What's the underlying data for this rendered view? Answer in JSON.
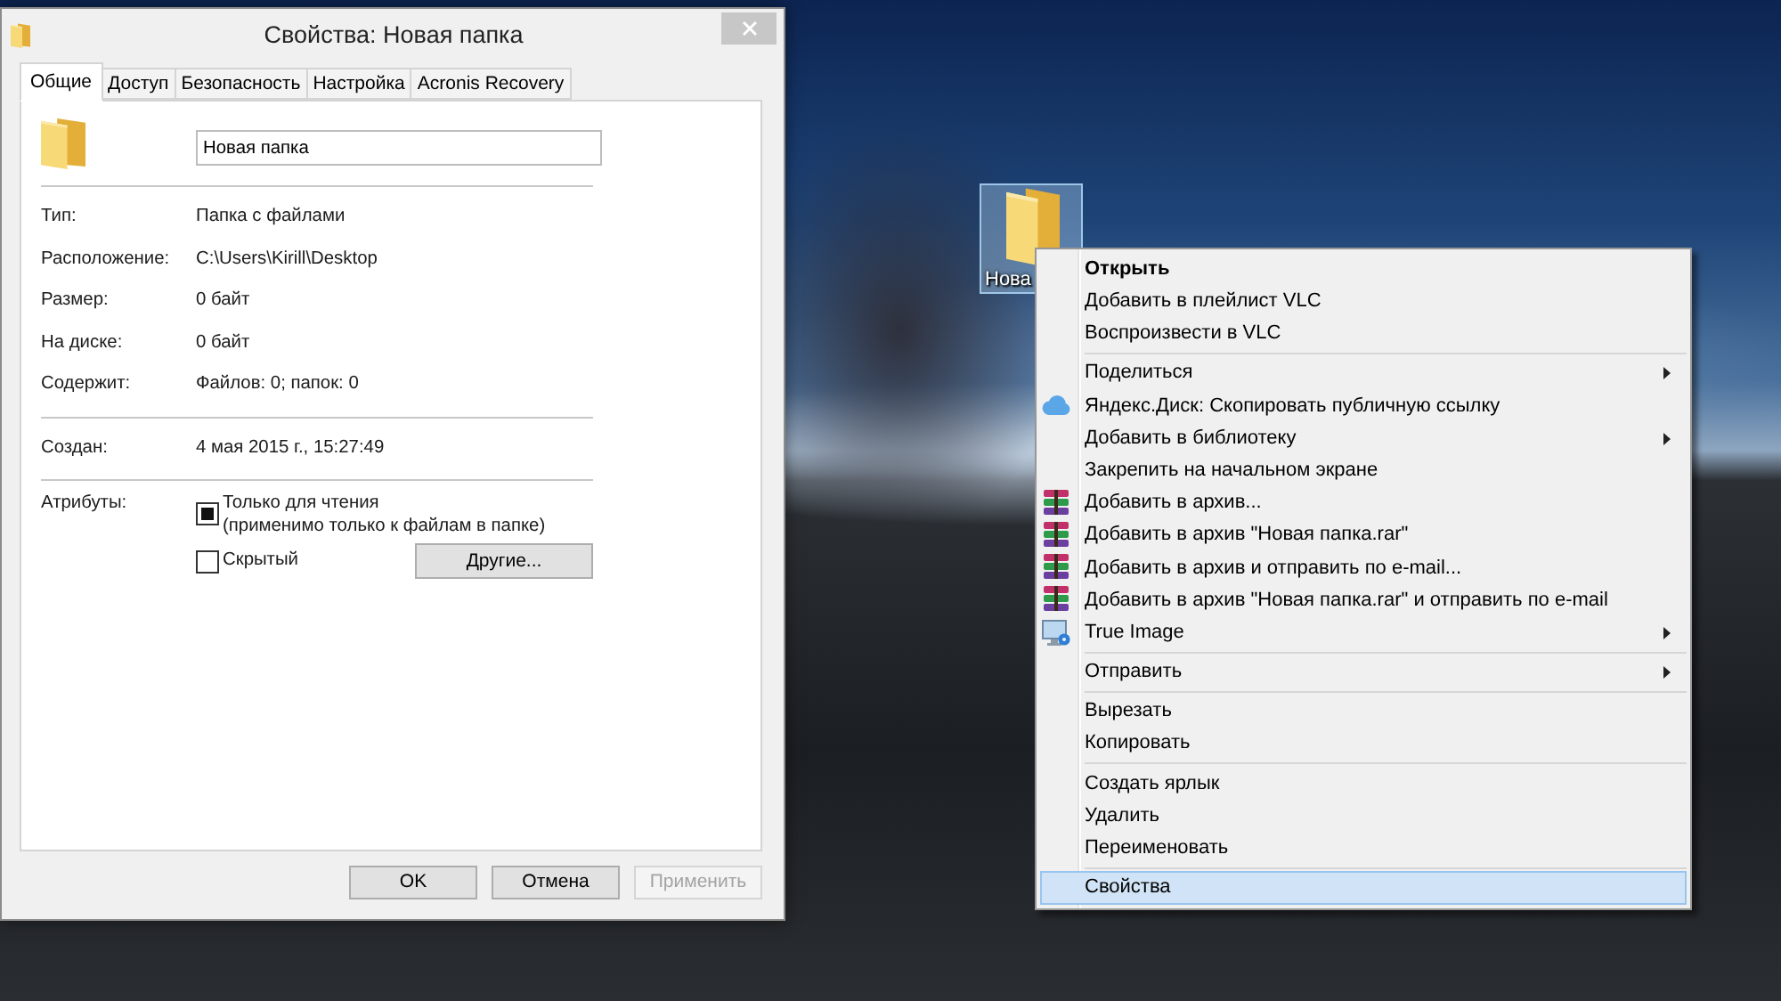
{
  "dialog": {
    "title": "Свойства: Новая папка",
    "tabs": [
      {
        "label": "Общие",
        "selected": true
      },
      {
        "label": "Доступ",
        "selected": false
      },
      {
        "label": "Безопасность",
        "selected": false
      },
      {
        "label": "Настройка",
        "selected": false
      },
      {
        "label": "Acronis Recovery",
        "selected": false
      }
    ],
    "name_field": {
      "value": "Новая папка"
    },
    "sections": [
      [
        {
          "label": "Тип:",
          "value": "Папка с файлами"
        },
        {
          "label": "Расположение:",
          "value": "C:\\Users\\Kirill\\Desktop"
        },
        {
          "label": "Размер:",
          "value": "0 байт"
        },
        {
          "label": "На диске:",
          "value": "0 байт"
        },
        {
          "label": "Содержит:",
          "value": "Файлов: 0; папок: 0"
        }
      ],
      [
        {
          "label": "Создан:",
          "value": "4 мая 2015 г., 15:27:49"
        }
      ]
    ],
    "attributes": {
      "label": "Атрибуты:",
      "checkboxes": [
        {
          "label": "Только для чтения",
          "note": "(применимо только к файлам в папке)",
          "checked": false,
          "indeterminate": true
        },
        {
          "label": "Скрытый",
          "checked": false,
          "indeterminate": false
        }
      ],
      "button": "Другие..."
    },
    "buttons": [
      {
        "label": "OK",
        "disabled": false
      },
      {
        "label": "Отмена",
        "disabled": false
      },
      {
        "label": "Применить",
        "disabled": true
      }
    ]
  },
  "desktop_item": {
    "label": "Нова",
    "selected": true
  },
  "context_menu": {
    "groups": [
      [
        {
          "label": "Открыть",
          "kind": "plain",
          "default": true,
          "submenu": false,
          "selected": false
        },
        {
          "label": "Добавить в плейлист VLC",
          "kind": "plain",
          "default": false,
          "submenu": false,
          "selected": false
        },
        {
          "label": "Воспроизвести в VLC",
          "kind": "plain",
          "default": false,
          "submenu": false,
          "selected": false
        }
      ],
      [
        {
          "label": "Поделиться",
          "kind": "plain",
          "default": false,
          "submenu": true,
          "selected": false
        },
        {
          "label": "Яндекс.Диск: Скопировать публичную ссылку",
          "kind": "cloud",
          "default": false,
          "submenu": false,
          "selected": false
        },
        {
          "label": "Добавить в библиотеку",
          "kind": "plain",
          "default": false,
          "submenu": true,
          "selected": false
        },
        {
          "label": "Закрепить на начальном экране",
          "kind": "plain",
          "default": false,
          "submenu": false,
          "selected": false
        },
        {
          "label": "Добавить в архив...",
          "kind": "archive",
          "default": false,
          "submenu": false,
          "selected": false
        },
        {
          "label": "Добавить в архив \"Новая папка.rar\"",
          "kind": "archive",
          "default": false,
          "submenu": false,
          "selected": false
        },
        {
          "label": "Добавить в архив и отправить по e-mail...",
          "kind": "archive",
          "default": false,
          "submenu": false,
          "selected": false
        },
        {
          "label": "Добавить в архив \"Новая папка.rar\" и отправить по e-mail",
          "kind": "archive",
          "default": false,
          "submenu": false,
          "selected": false
        },
        {
          "label": "True Image",
          "kind": "monitor",
          "default": false,
          "submenu": true,
          "selected": false
        }
      ],
      [
        {
          "label": "Отправить",
          "kind": "plain",
          "default": false,
          "submenu": true,
          "selected": false
        }
      ],
      [
        {
          "label": "Вырезать",
          "kind": "plain",
          "default": false,
          "submenu": false,
          "selected": false
        },
        {
          "label": "Копировать",
          "kind": "plain",
          "default": false,
          "submenu": false,
          "selected": false
        }
      ],
      [
        {
          "label": "Создать ярлык",
          "kind": "plain",
          "default": false,
          "submenu": false,
          "selected": false
        },
        {
          "label": "Удалить",
          "kind": "plain",
          "default": false,
          "submenu": false,
          "selected": false
        },
        {
          "label": "Переименовать",
          "kind": "plain",
          "default": false,
          "submenu": false,
          "selected": false
        }
      ],
      [
        {
          "label": "Свойства",
          "kind": "plain",
          "default": false,
          "submenu": false,
          "selected": true
        }
      ]
    ]
  }
}
